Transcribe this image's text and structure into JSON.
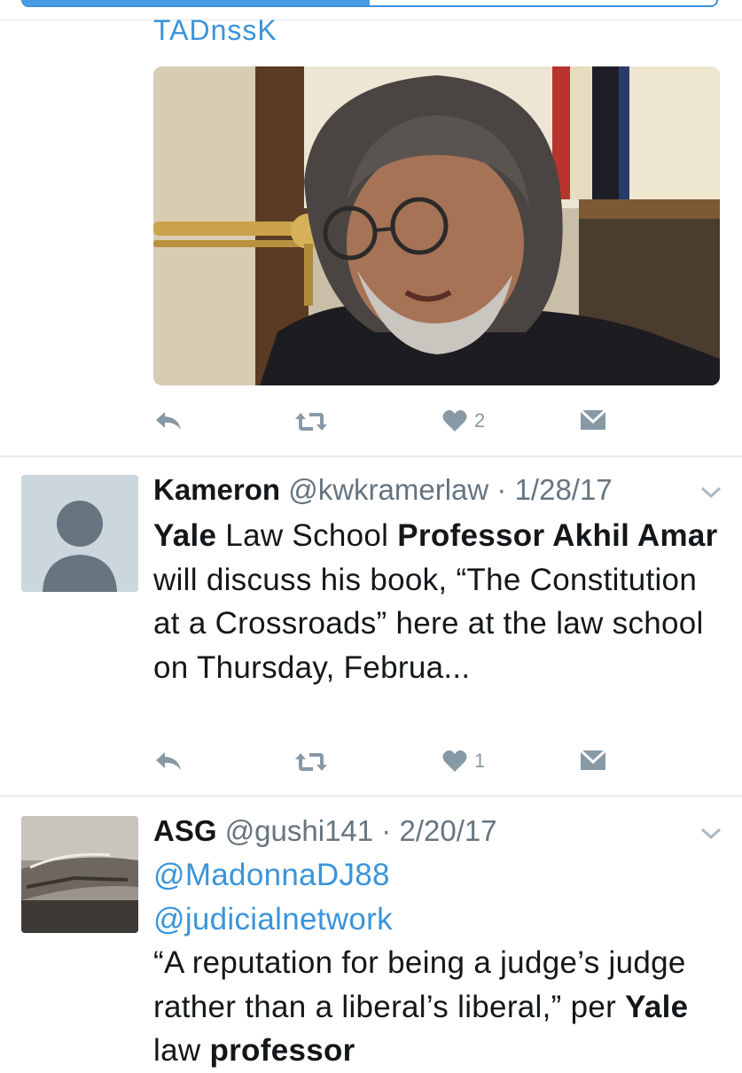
{
  "tabs": {
    "left": "",
    "right": ""
  },
  "tweet_above": {
    "link_fragment": "TADnssK",
    "actions": {
      "likes": "2"
    }
  },
  "tweet1": {
    "name": "Kameron",
    "handle": "@kwkramerlaw",
    "sep": " · ",
    "date": "1/28/17",
    "text": {
      "s1": "Yale",
      "s2": " Law School ",
      "s3": "Professor Akhil Amar",
      "s4": " will discuss his book, “The Constitution at a Crossroads” here at the law school on Thursday, Februa..."
    },
    "actions": {
      "likes": "1"
    }
  },
  "tweet2": {
    "name": "ASG",
    "handle": "@gushi141",
    "sep": " · ",
    "date": "2/20/17",
    "mention1": "@MadonnaDJ88",
    "mention2": "@judicialnetwork",
    "text": {
      "s1": "“A reputation for being a judge’s judge rather than a liberal’s liberal,” per ",
      "s2": "Yale",
      "s3": " law ",
      "s4": "professor"
    }
  },
  "colors": {
    "link": "#3b94d9",
    "icon": "#8899a6",
    "tab_active": "#4a9ae6"
  }
}
